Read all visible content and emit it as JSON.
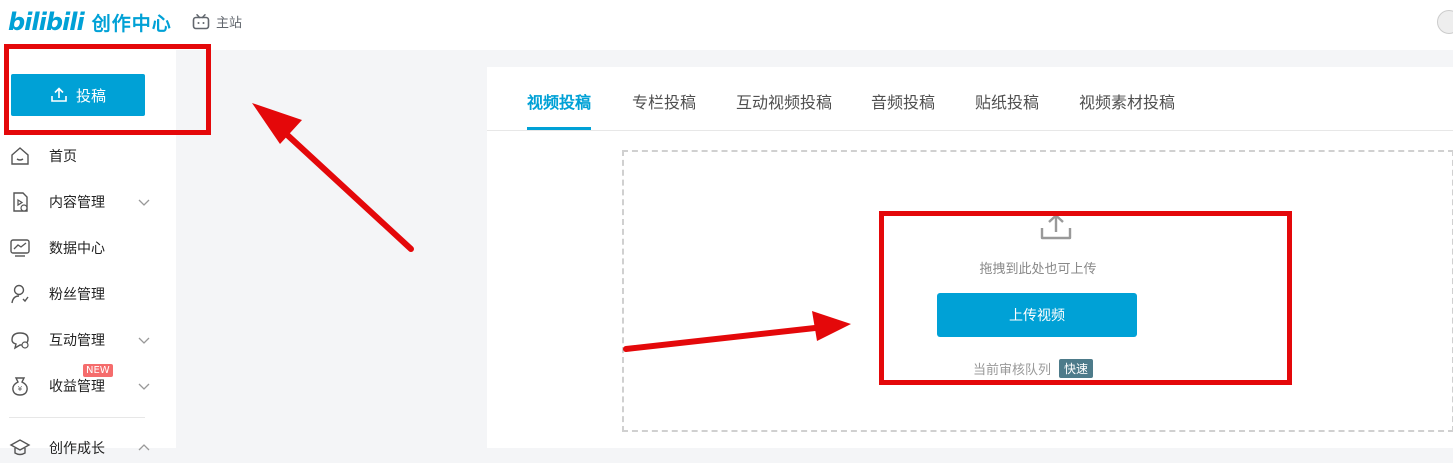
{
  "header": {
    "logo_text": "bilibili",
    "logo_subtitle": "创作中心",
    "home_link": "主站"
  },
  "sidebar": {
    "upload_button": "投稿",
    "items": [
      {
        "label": "首页",
        "icon": "home-icon",
        "has_chevron": false
      },
      {
        "label": "内容管理",
        "icon": "content-icon",
        "has_chevron": true
      },
      {
        "label": "数据中心",
        "icon": "chart-icon",
        "has_chevron": false
      },
      {
        "label": "粉丝管理",
        "icon": "fans-icon",
        "has_chevron": false
      },
      {
        "label": "互动管理",
        "icon": "chat-icon",
        "has_chevron": true
      },
      {
        "label": "收益管理",
        "icon": "money-bag-icon",
        "has_chevron": true,
        "badge": "NEW"
      },
      {
        "label": "创作成长",
        "icon": "growth-icon",
        "has_chevron": true
      }
    ]
  },
  "tabs": [
    {
      "label": "视频投稿",
      "active": true
    },
    {
      "label": "专栏投稿",
      "active": false
    },
    {
      "label": "互动视频投稿",
      "active": false
    },
    {
      "label": "音频投稿",
      "active": false
    },
    {
      "label": "贴纸投稿",
      "active": false
    },
    {
      "label": "视频素材投稿",
      "active": false
    }
  ],
  "upload_area": {
    "drag_hint": "拖拽到此处也可上传",
    "upload_button": "上传视频",
    "queue_label": "当前审核队列",
    "queue_status": "快速"
  },
  "colors": {
    "accent": "#00a1d6",
    "annotation": "#e4080a",
    "badge_new": "#f56c6c",
    "queue_badge": "#4d7b8a"
  }
}
